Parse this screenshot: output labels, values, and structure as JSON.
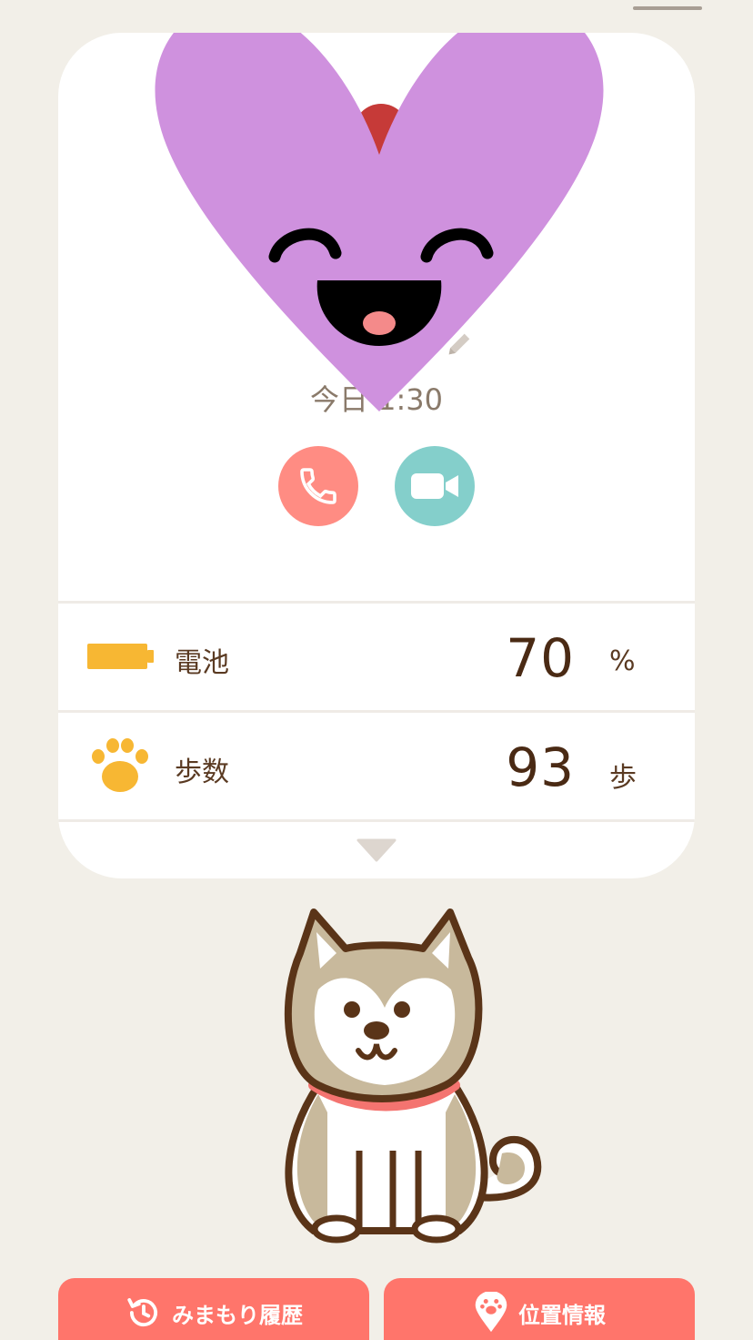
{
  "profile": {
    "name": "",
    "last_update": "今日 1:30"
  },
  "actions": {
    "voice_call_icon": "phone-icon",
    "video_call_icon": "video-camera-icon"
  },
  "stats": [
    {
      "label": "電池",
      "value": "70",
      "unit": "%",
      "icon": "battery-icon"
    },
    {
      "label": "歩数",
      "value": "93",
      "unit": "歩",
      "icon": "paw-icon"
    }
  ],
  "bottom_nav": {
    "history_label": "みまもり履歴",
    "location_label": "位置情報"
  },
  "colors": {
    "background": "#f2efe8",
    "accent_coral": "#ff756b",
    "call_button": "#ff8c83",
    "video_button": "#84cfcb",
    "stat_icon": "#f7b733",
    "avatar": "#cf91de"
  }
}
